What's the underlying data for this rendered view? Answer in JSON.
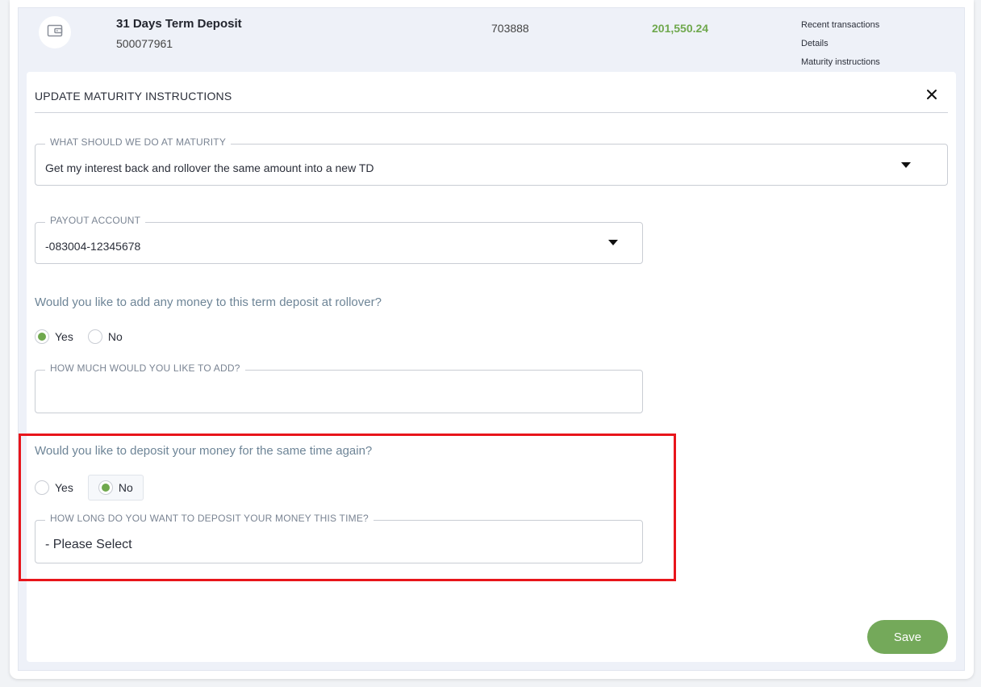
{
  "account": {
    "icon": "wallet-icon",
    "name": "31 Days Term Deposit",
    "number": "500077961",
    "bsb": "703888",
    "balance": "201,550.24",
    "links": [
      "Recent transactions",
      "Details",
      "Maturity instructions"
    ]
  },
  "dialog": {
    "title": "UPDATE MATURITY INSTRUCTIONS",
    "close_icon": "close-icon",
    "maturity": {
      "legend": "WHAT SHOULD WE DO AT MATURITY",
      "value": "Get my interest back and rollover the same amount into a new TD"
    },
    "payout": {
      "legend": "PAYOUT ACCOUNT",
      "value": "-083004-12345678"
    },
    "add_money": {
      "question": "Would you like to add any money to this term deposit at rollover?",
      "yes": "Yes",
      "no": "No",
      "selected": "yes"
    },
    "add_amount": {
      "legend": "HOW MUCH WOULD YOU LIKE TO ADD?",
      "value": ""
    },
    "same_time": {
      "question": "Would you like to deposit your money for the same time again?",
      "yes": "Yes",
      "no": "No",
      "selected": "no"
    },
    "duration": {
      "legend": "HOW LONG DO YOU WANT TO DEPOSIT YOUR MONEY THIS TIME?",
      "value": "- Please Select"
    },
    "save_label": "Save"
  },
  "colors": {
    "accent_green": "#6fa84d",
    "save_button": "#74a95a",
    "highlight_red": "#e8151b"
  }
}
